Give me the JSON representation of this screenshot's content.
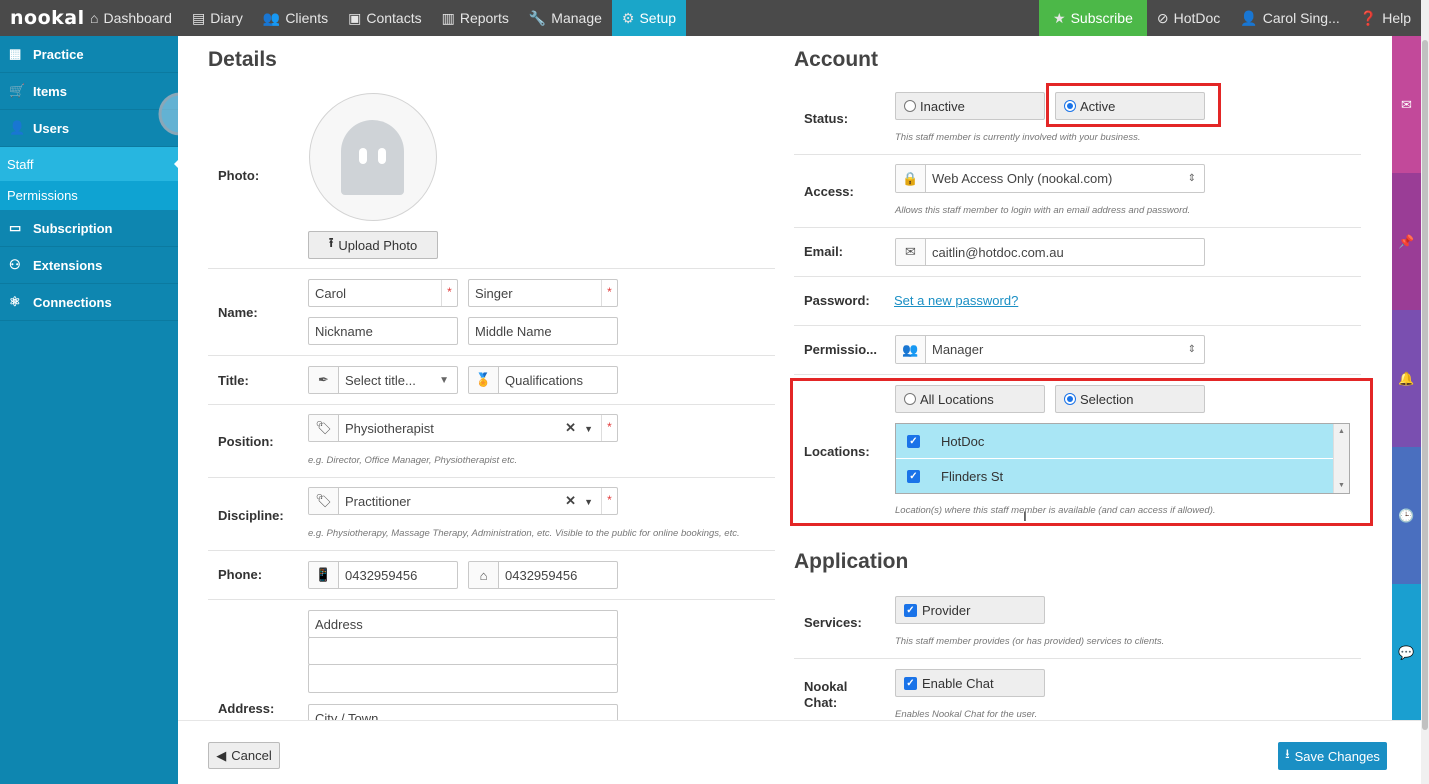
{
  "nav": {
    "logo": "nookal",
    "items": [
      {
        "label": "Dashboard",
        "icon": "home-icon",
        "glyph": "⌂"
      },
      {
        "label": "Diary",
        "icon": "book-icon",
        "glyph": "▤"
      },
      {
        "label": "Clients",
        "icon": "users-icon",
        "glyph": "👥"
      },
      {
        "label": "Contacts",
        "icon": "contact-card-icon",
        "glyph": "▣"
      },
      {
        "label": "Reports",
        "icon": "bar-chart-icon",
        "glyph": "▥"
      },
      {
        "label": "Manage",
        "icon": "wrench-icon",
        "glyph": "🔧"
      },
      {
        "label": "Setup",
        "icon": "gear-icon",
        "glyph": "⚙"
      }
    ],
    "right": [
      {
        "label": "Subscribe",
        "icon": "star-icon",
        "glyph": "★"
      },
      {
        "label": "HotDoc",
        "icon": "compass-icon",
        "glyph": "⊘"
      },
      {
        "label": "Carol Sing...",
        "icon": "user-icon",
        "glyph": "👤"
      },
      {
        "label": "Help",
        "icon": "question-icon",
        "glyph": "❓"
      }
    ]
  },
  "sidebar": {
    "items_top": [
      {
        "label": "Practice",
        "icon": "building-icon",
        "glyph": "▦"
      },
      {
        "label": "Items",
        "icon": "cart-icon",
        "glyph": "🛒"
      },
      {
        "label": "Users",
        "icon": "user-icon",
        "glyph": "👤"
      }
    ],
    "sub": [
      "Staff",
      "Permissions"
    ],
    "items_bottom": [
      {
        "label": "Subscription",
        "icon": "wallet-icon",
        "glyph": "▭"
      },
      {
        "label": "Extensions",
        "icon": "gamepad-icon",
        "glyph": "⚇"
      },
      {
        "label": "Connections",
        "icon": "atom-icon",
        "glyph": "⚛"
      }
    ]
  },
  "details": {
    "heading": "Details",
    "photo_label": "Photo:",
    "upload_label": "Upload Photo",
    "name_label": "Name:",
    "first_name": "Carol",
    "last_name": "Singer",
    "nickname_placeholder": "Nickname",
    "middle_placeholder": "Middle Name",
    "title_label": "Title:",
    "title_placeholder": "Select title...",
    "qualifications_placeholder": "Qualifications",
    "position_label": "Position:",
    "position_value": "Physiotherapist",
    "position_hint": "e.g. Director, Office Manager, Physiotherapist etc.",
    "discipline_label": "Discipline:",
    "discipline_value": "Practitioner",
    "discipline_hint": "e.g. Physiotherapy, Massage Therapy, Administration, etc. Visible to the public for online bookings, etc.",
    "phone_label": "Phone:",
    "mobile": "0432959456",
    "home": "0432959456",
    "address_label": "Address:",
    "address_placeholder": "Address",
    "city_placeholder": "City / Town"
  },
  "account": {
    "heading": "Account",
    "status_label": "Status:",
    "inactive_label": "Inactive",
    "active_label": "Active",
    "status_selected": "Active",
    "status_hint": "This staff member is currently involved with your business.",
    "access_label": "Access:",
    "access_value": "Web Access Only (nookal.com)",
    "access_hint": "Allows this staff member to login with an email address and password.",
    "email_label": "Email:",
    "email_value": "caitlin@hotdoc.com.au",
    "password_label": "Password:",
    "password_link": "Set a new password?",
    "permissions_label": "Permissio...",
    "permissions_value": "Manager",
    "locations_label": "Locations:",
    "all_locations_label": "All Locations",
    "selection_label": "Selection",
    "locations_selected_mode": "Selection",
    "locations": [
      {
        "name": "HotDoc",
        "checked": true
      },
      {
        "name": "Flinders St",
        "checked": true
      }
    ],
    "locations_hint": "Location(s) where this staff member is available (and can access if allowed)."
  },
  "application": {
    "heading": "Application",
    "services_label": "Services:",
    "provider_label": "Provider",
    "provider_checked": true,
    "services_hint": "This staff member provides (or has provided) services to clients.",
    "chat_label_1": "Nookal",
    "chat_label_2": "Chat:",
    "chat_option": "Enable Chat",
    "chat_checked": true,
    "chat_hint": "Enables Nookal Chat for the user."
  },
  "footer": {
    "cancel_label": "Cancel",
    "save_label": "Save Changes"
  },
  "strip": [
    {
      "icon": "envelope-icon",
      "color": "#c2499a"
    },
    {
      "icon": "pin-icon",
      "color": "#9a3d96"
    },
    {
      "icon": "bell-icon",
      "color": "#7a4fb0"
    },
    {
      "icon": "clock-icon",
      "color": "#4a6fbf"
    },
    {
      "icon": "chat-bubble-icon",
      "color": "#1a9fd0"
    }
  ],
  "colors": {
    "nav_bg": "#4a4a4a",
    "setup_active": "#1aa6c9",
    "subscribe": "#4cb848",
    "sidebar": "#0e86b0",
    "highlight_box": "#e32626",
    "save_button": "#1a8fc4"
  }
}
